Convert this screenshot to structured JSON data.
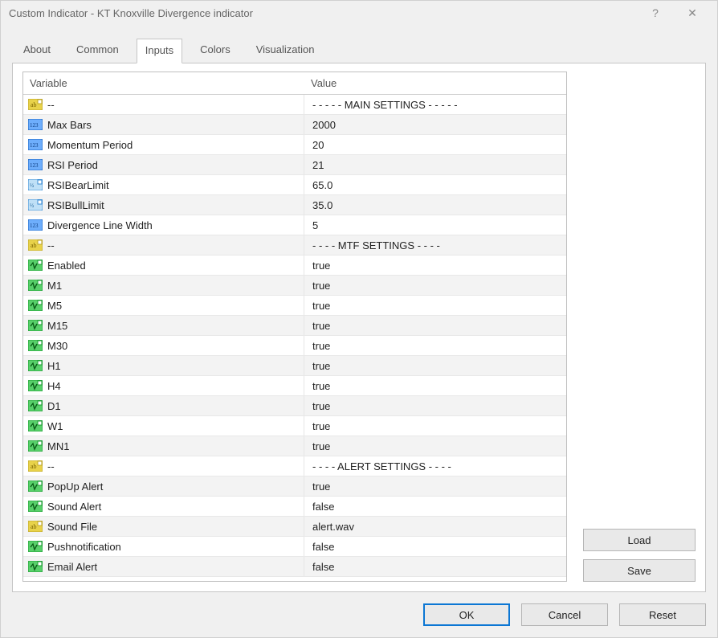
{
  "window": {
    "title": "Custom Indicator - KT Knoxville Divergence indicator"
  },
  "tabs": {
    "about": "About",
    "common": "Common",
    "inputs": "Inputs",
    "colors": "Colors",
    "visualization": "Visualization"
  },
  "headers": {
    "variable": "Variable",
    "value": "Value"
  },
  "rows": [
    {
      "icon": "str",
      "variable": "--",
      "value": "- - - - - MAIN SETTINGS - - - - -"
    },
    {
      "icon": "int",
      "variable": "Max Bars",
      "value": "2000"
    },
    {
      "icon": "int",
      "variable": "Momentum Period",
      "value": "20"
    },
    {
      "icon": "int",
      "variable": "RSI Period",
      "value": "21"
    },
    {
      "icon": "dbl",
      "variable": "RSIBearLimit",
      "value": "65.0"
    },
    {
      "icon": "dbl",
      "variable": "RSIBullLimit",
      "value": "35.0"
    },
    {
      "icon": "int",
      "variable": "Divergence Line Width",
      "value": "5"
    },
    {
      "icon": "str",
      "variable": "--",
      "value": "- - - - MTF SETTINGS - - - -"
    },
    {
      "icon": "bool",
      "variable": "Enabled",
      "value": "true"
    },
    {
      "icon": "bool",
      "variable": "M1",
      "value": "true"
    },
    {
      "icon": "bool",
      "variable": "M5",
      "value": "true"
    },
    {
      "icon": "bool",
      "variable": "M15",
      "value": "true"
    },
    {
      "icon": "bool",
      "variable": "M30",
      "value": "true"
    },
    {
      "icon": "bool",
      "variable": "H1",
      "value": "true"
    },
    {
      "icon": "bool",
      "variable": "H4",
      "value": "true"
    },
    {
      "icon": "bool",
      "variable": "D1",
      "value": "true"
    },
    {
      "icon": "bool",
      "variable": "W1",
      "value": "true"
    },
    {
      "icon": "bool",
      "variable": "MN1",
      "value": "true"
    },
    {
      "icon": "str",
      "variable": "--",
      "value": "- - - - ALERT SETTINGS - - - -"
    },
    {
      "icon": "bool",
      "variable": "PopUp Alert",
      "value": "true"
    },
    {
      "icon": "bool",
      "variable": "Sound Alert",
      "value": "false"
    },
    {
      "icon": "str",
      "variable": "Sound File",
      "value": "alert.wav"
    },
    {
      "icon": "bool",
      "variable": "Pushnotification",
      "value": "false"
    },
    {
      "icon": "bool",
      "variable": "Email Alert",
      "value": "false"
    }
  ],
  "buttons": {
    "load": "Load",
    "save": "Save",
    "ok": "OK",
    "cancel": "Cancel",
    "reset": "Reset"
  }
}
